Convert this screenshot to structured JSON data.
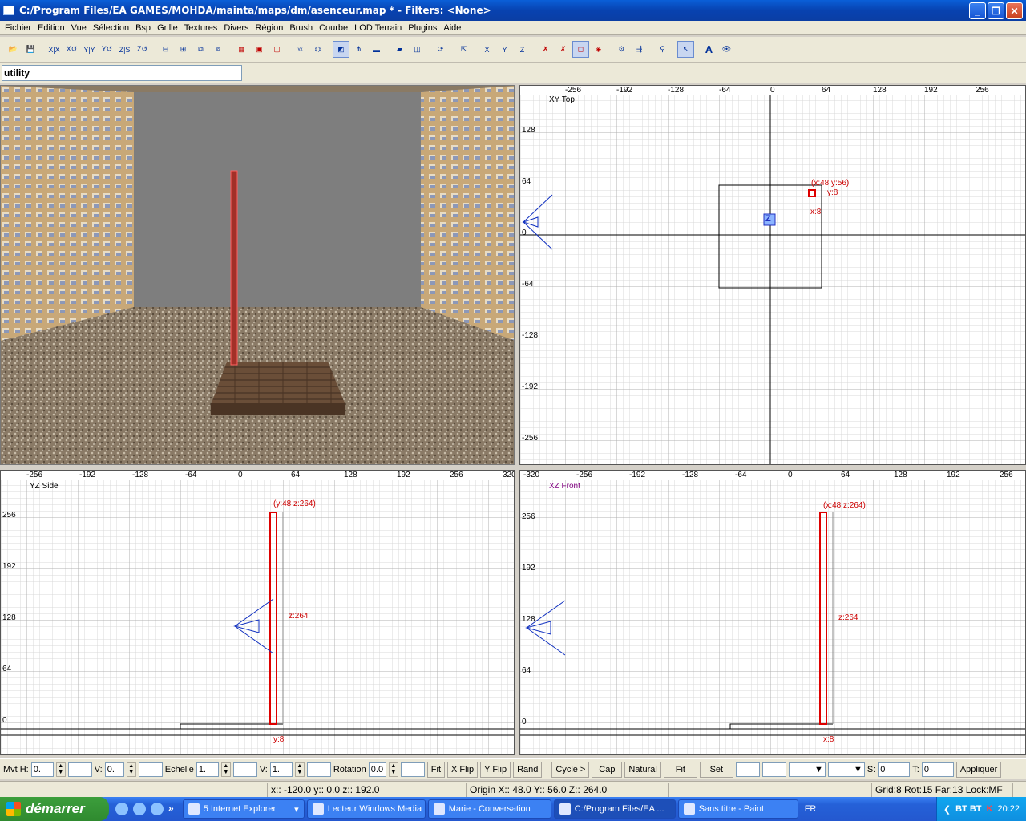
{
  "window": {
    "title": "C:/Program Files/EA GAMES/MOHDA/mainta/maps/dm/asenceur.map * - Filters: <None>"
  },
  "menu": [
    "Fichier",
    "Edition",
    "Vue",
    "Sélection",
    "Bsp",
    "Grille",
    "Textures",
    "Divers",
    "Région",
    "Brush",
    "Courbe",
    "LOD Terrain",
    "Plugins",
    "Aide"
  ],
  "filter": {
    "value": "utility"
  },
  "views": {
    "xy": {
      "name": "XY Top",
      "h_ticks": [
        "-256",
        "-192",
        "-128",
        "-64",
        "0",
        "64",
        "128",
        "192",
        "256"
      ],
      "v_ticks": [
        "128",
        "64",
        "0",
        "-64",
        "-128",
        "-192",
        "-256"
      ],
      "sel_label": "(x:48  y:56)",
      "size_y": "y:8",
      "size_x": "x:8",
      "z_label": "Z"
    },
    "yz": {
      "name": "YZ Side",
      "h_ticks": [
        "-256",
        "-192",
        "-128",
        "-64",
        "0",
        "64",
        "128",
        "192",
        "256",
        "320"
      ],
      "v_ticks": [
        "256",
        "192",
        "128",
        "64",
        "0"
      ],
      "sel_label": "(y:48  z:264)",
      "size_z": "z:264",
      "size_y": "y:8"
    },
    "xz": {
      "name": "XZ Front",
      "h_ticks": [
        "-320",
        "-256",
        "-192",
        "-128",
        "-64",
        "0",
        "64",
        "128",
        "192",
        "256"
      ],
      "v_ticks": [
        "256",
        "192",
        "128",
        "64",
        "0"
      ],
      "sel_label": "(x:48  z:264)",
      "size_z": "z:264",
      "size_x": "x:8"
    }
  },
  "surface": {
    "mvt_label": "Mvt",
    "h_label": "H:",
    "h_value": "0.",
    "v_label": "V:",
    "v_value": "0.",
    "scale_label": "Echelle",
    "scale_h": "1.",
    "scale_v_label": "V:",
    "scale_v": "1.",
    "rotation_label": "Rotation",
    "rotation_value": "0.0",
    "fit": "Fit",
    "xflip": "X Flip",
    "yflip": "Y Flip",
    "rand": "Rand",
    "cycle": "Cycle >",
    "cap": "Cap",
    "natural": "Natural",
    "fit2": "Fit",
    "set": "Set",
    "s_label": "S:",
    "s_value": "0",
    "t_label": "T:",
    "t_value": "0",
    "apply": "Appliquer"
  },
  "status": {
    "cursor": "x:: -120.0  y:: 0.0  z:: 192.0",
    "origin": "Origin X:: 48.0  Y:: 56.0  Z:: 264.0",
    "grid": "Grid:8 Rot:15 Far:13 Lock:MF"
  },
  "taskbar": {
    "start": "démarrer",
    "tasks": [
      "5 Internet Explorer",
      "Lecteur Windows Media",
      "Marie - Conversation",
      "C:/Program Files/EA ...",
      "Sans titre - Paint"
    ],
    "lang": "FR",
    "tray_text": "BT BT",
    "clock": "20:22"
  },
  "toolbar_icons": [
    "open-icon",
    "save-icon",
    "flip-x-icon",
    "flip-y-icon",
    "flip-z-icon",
    "rotate-x-icon",
    "rotate-y-icon",
    "rotate-z-icon"
  ]
}
